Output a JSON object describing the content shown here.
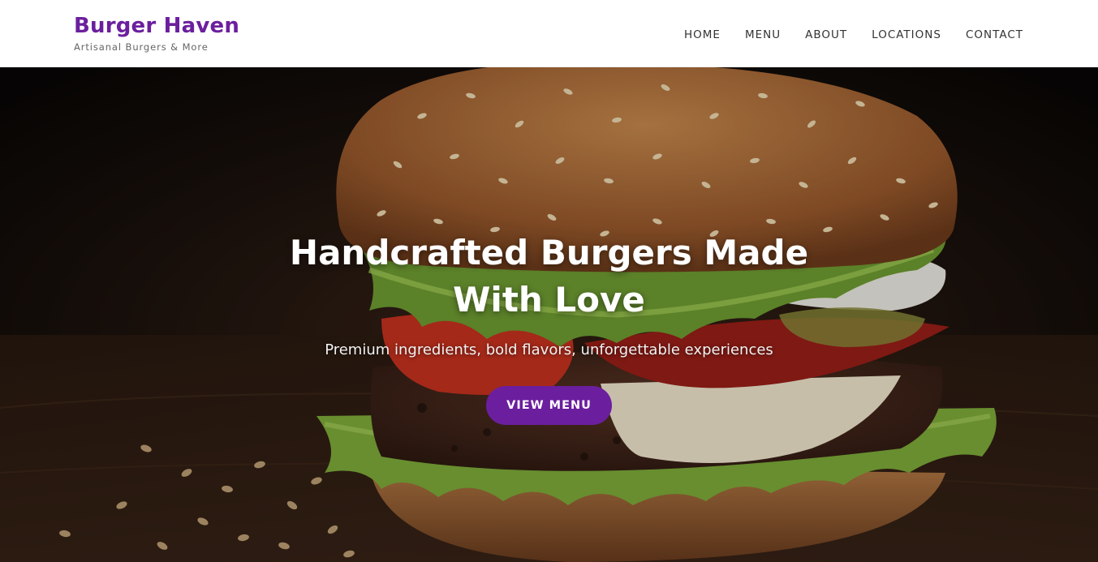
{
  "brand": {
    "name": "Burger Haven",
    "tagline": "Artisanal Burgers & More"
  },
  "nav": {
    "items": [
      "HOME",
      "MENU",
      "ABOUT",
      "LOCATIONS",
      "CONTACT"
    ]
  },
  "hero": {
    "title": "Handcrafted Burgers Made With Love",
    "subtitle": "Premium ingredients, bold flavors, unforgettable experiences",
    "cta_label": "VIEW MENU",
    "image_subject": "sesame-bun-cheeseburger-photo"
  },
  "colors": {
    "accent": "#6b1f9e",
    "header_bg": "#ffffff",
    "nav_text": "#333333",
    "hero_text": "#ffffff"
  }
}
